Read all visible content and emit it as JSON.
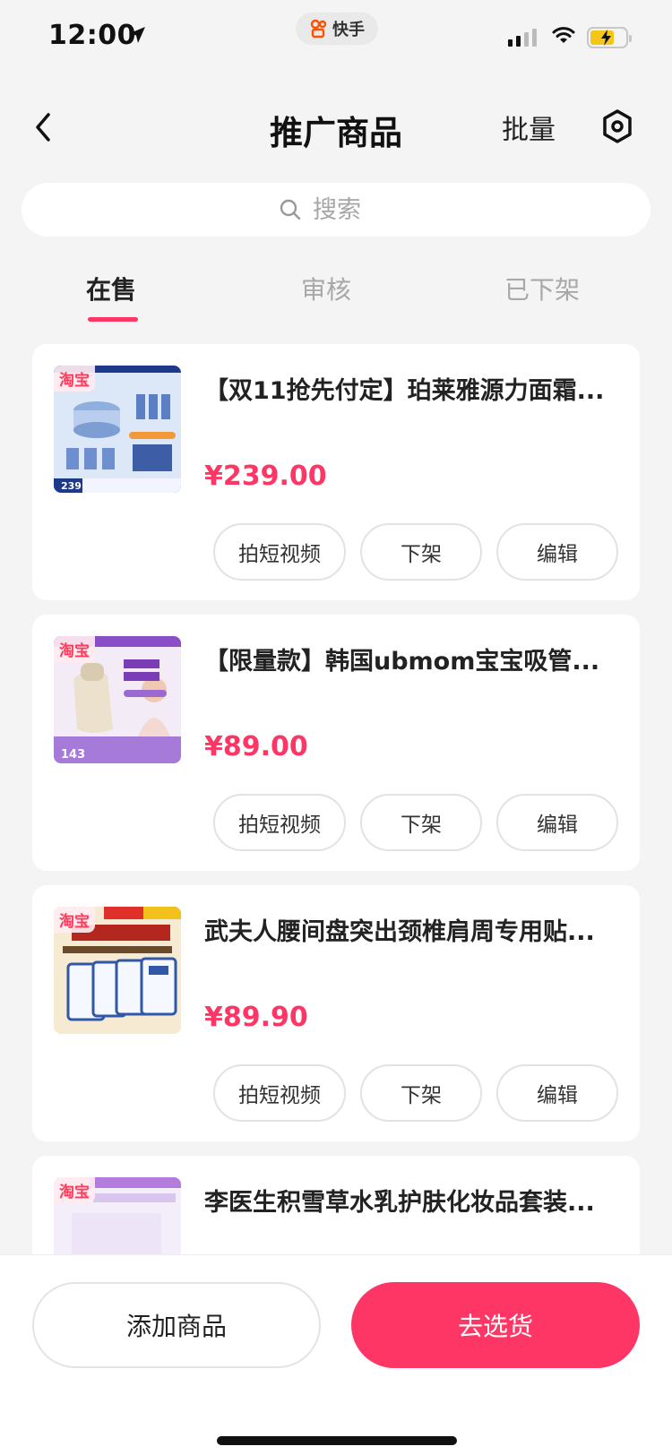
{
  "status_bar": {
    "time": "12:00",
    "app_name": "快手"
  },
  "header": {
    "title": "推广商品",
    "batch_label": "批量"
  },
  "search": {
    "placeholder": "搜索"
  },
  "tabs": [
    {
      "label": "在售",
      "active": true
    },
    {
      "label": "审核",
      "active": false
    },
    {
      "label": "已下架",
      "active": false
    }
  ],
  "products": [
    {
      "source": "淘宝",
      "title": "【双11抢先付定】珀莱雅源力面霜...",
      "price": "¥239.00",
      "thumb_text": "239"
    },
    {
      "source": "淘宝",
      "title": "【限量款】韩国ubmom宝宝吸管...",
      "price": "¥89.00",
      "thumb_text": "143"
    },
    {
      "source": "淘宝",
      "title": "武夫人腰间盘突出颈椎肩周专用贴...",
      "price": "¥89.90",
      "thumb_text": ""
    },
    {
      "source": "淘宝",
      "title": "李医生积雪草水乳护肤化妆品套装...",
      "price": "",
      "thumb_text": ""
    }
  ],
  "card_buttons": {
    "shoot": "拍短视频",
    "delist": "下架",
    "edit": "编辑"
  },
  "bottom": {
    "add_label": "添加商品",
    "pick_label": "去选货"
  },
  "colors": {
    "accent": "#fe3666",
    "background": "#f4f4f5"
  }
}
